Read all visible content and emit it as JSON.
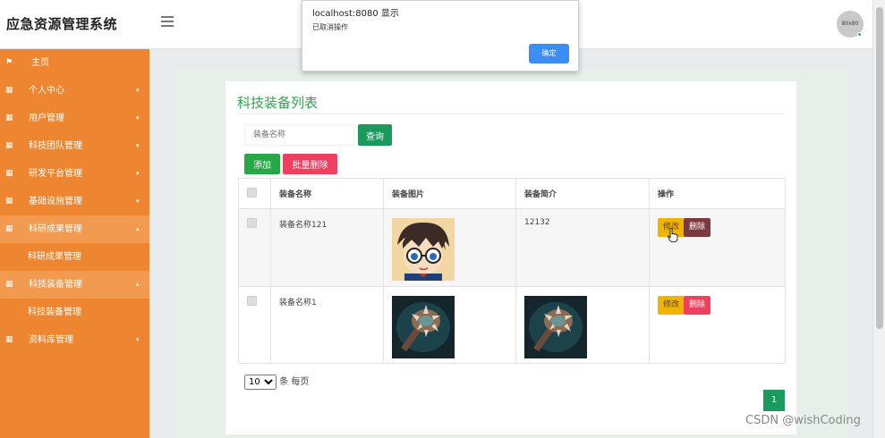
{
  "header": {
    "app_title": "应急资源管理系统",
    "avatar_text": "80x80"
  },
  "sidebar": {
    "items": [
      {
        "label": "主页",
        "icon": "flag-icon"
      },
      {
        "label": "个人中心",
        "icon": "grid-icon"
      },
      {
        "label": "用户管理",
        "icon": "grid-icon"
      },
      {
        "label": "科技团队管理",
        "icon": "grid-icon"
      },
      {
        "label": "研发平台管理",
        "icon": "grid-icon"
      },
      {
        "label": "基础设施管理",
        "icon": "grid-icon"
      },
      {
        "label": "科研成果管理",
        "icon": "grid-icon",
        "sub": "科研成果管理"
      },
      {
        "label": "科技装备管理",
        "icon": "grid-icon",
        "sub": "科技装备管理"
      },
      {
        "label": "资料库管理",
        "icon": "grid-icon"
      }
    ]
  },
  "main": {
    "title": "科技装备列表",
    "search": {
      "placeholder": "装备名称"
    },
    "buttons": {
      "query": "查询",
      "add": "添加",
      "batch_delete": "批量删除"
    },
    "table": {
      "columns": [
        "",
        "装备名称",
        "装备图片",
        "装备简介",
        "操作"
      ],
      "rows": [
        {
          "name": "装备名称121",
          "image": "anime-boy-glasses-image",
          "desc": "12132",
          "edit": "修改",
          "delete": "删除"
        },
        {
          "name": "装备名称1",
          "image": "spiked-mace-image",
          "desc_image": "spiked-mace-image",
          "edit": "修改",
          "delete": "删除"
        }
      ]
    },
    "pagination": {
      "page_size": "10",
      "page_size_options": [
        "10"
      ],
      "per_page_label": "条 每页",
      "current_page": "1"
    }
  },
  "dialog": {
    "title": "localhost:8080 显示",
    "message": "已取消操作",
    "ok": "确定"
  },
  "watermark": "CSDN @wishCoding",
  "colors": {
    "sidebar": "#ee8631",
    "accent_green": "#1a9a5c",
    "danger": "#f0405f",
    "warning": "#f0b400"
  }
}
